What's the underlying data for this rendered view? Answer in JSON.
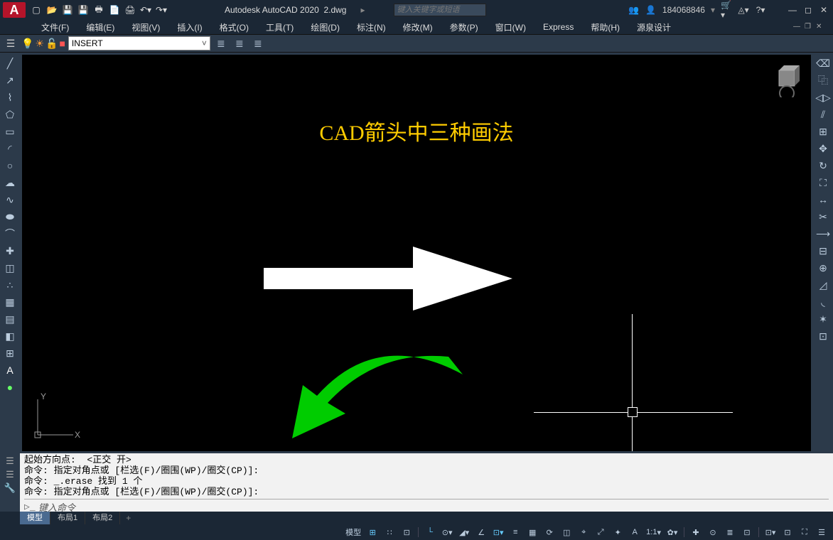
{
  "title": {
    "app": "Autodesk AutoCAD 2020",
    "doc": "2.dwg",
    "search_placeholder": "键入关键字或短语",
    "user": "184068846"
  },
  "menubar": {
    "items": [
      "文件(F)",
      "编辑(E)",
      "视图(V)",
      "插入(I)",
      "格式(O)",
      "工具(T)",
      "绘图(D)",
      "标注(N)",
      "修改(M)",
      "参数(P)",
      "窗口(W)",
      "Express",
      "帮助(H)",
      "源泉设计"
    ]
  },
  "layerbar": {
    "current_layer": "INSERT"
  },
  "canvas": {
    "title_text": "CAD箭头中三种画法",
    "ucs_x": "X",
    "ucs_y": "Y"
  },
  "command": {
    "lines": [
      "起始方向点:  <正交 开>",
      "命令: 指定对角点或 [栏选(F)/圈围(WP)/圈交(CP)]:",
      "命令: _.erase 找到 1 个",
      "命令: 指定对角点或 [栏选(F)/圈围(WP)/圈交(CP)]:"
    ],
    "prompt": "键入命令"
  },
  "tabs": {
    "items": [
      "模型",
      "布局1",
      "布局2"
    ],
    "active": 0
  },
  "statusbar": {
    "model_label": "模型",
    "scale": "1:1",
    "annoscale": "A"
  }
}
